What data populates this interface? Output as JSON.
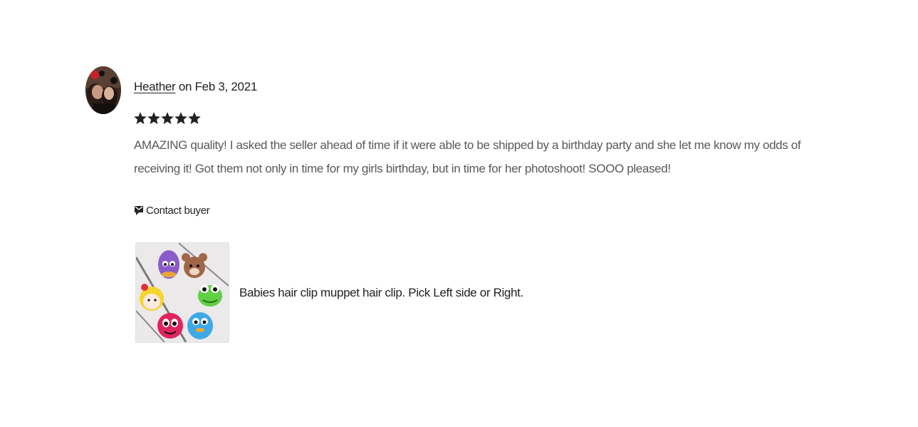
{
  "review": {
    "reviewer_name": "Heather",
    "date_prefix": "on",
    "date": "Feb 3, 2021",
    "rating": 5,
    "rating_max": 5,
    "star_glyph": "star-icon",
    "text": "AMAZING quality! I asked the seller ahead of time if it were able to be shipped by a birthday party and she let me know my odds of receiving it! Got them not only in time for my girls birthday, but in time for her photoshoot! SOOO pleased!",
    "contact_label": "Contact buyer",
    "contact_icon": "message-icon"
  },
  "listing": {
    "title": "Babies hair clip muppet hair clip. Pick Left side or Right."
  },
  "colors": {
    "text_primary": "#222222",
    "text_secondary": "#595959",
    "star": "#222222"
  }
}
